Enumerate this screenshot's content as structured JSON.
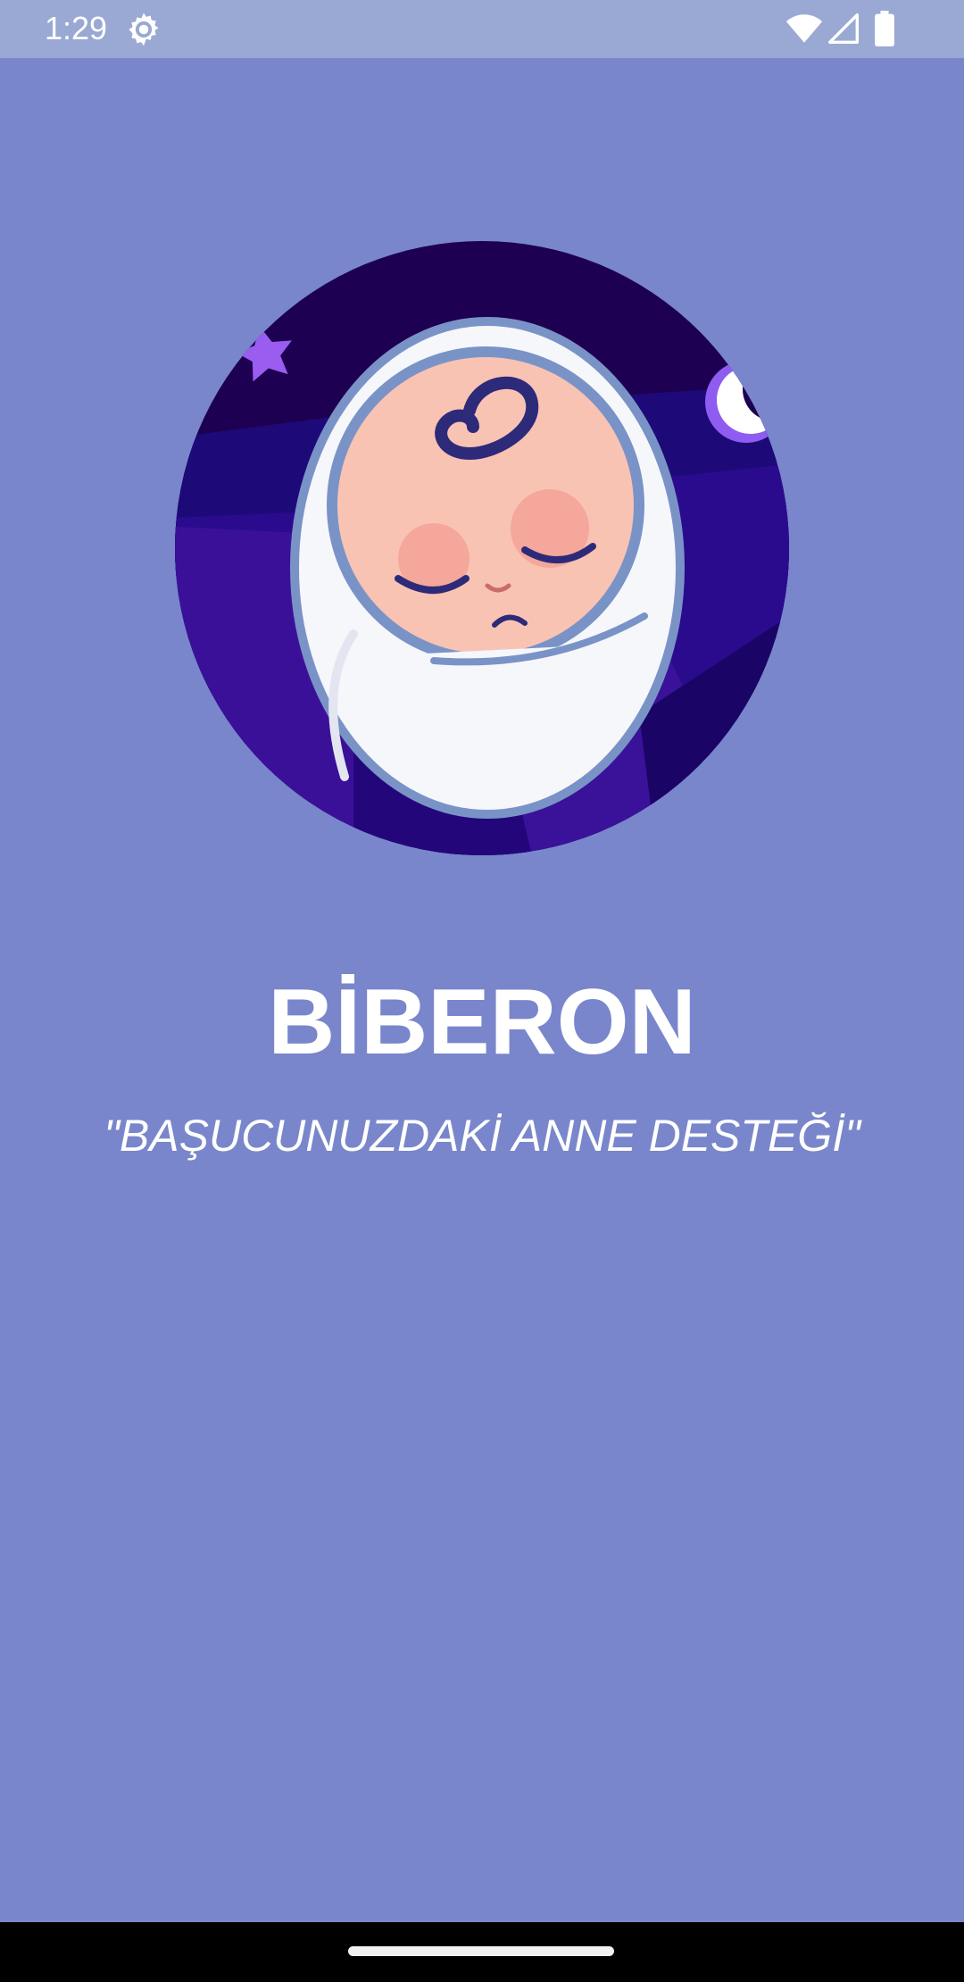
{
  "status_bar": {
    "time": "1:29",
    "icons": [
      "settings-gear-icon",
      "wifi-icon",
      "cell-signal-icon",
      "battery-icon"
    ]
  },
  "splash": {
    "logo_icon": "sleeping-baby-icon",
    "title": "BİBERON",
    "slogan": "\"BAŞUCUNUZDAKİ ANNE DESTEĞİ\""
  },
  "colors": {
    "background": "#7986cb",
    "status_bar": "#9aa9d3",
    "logo_circle": "#1e0052",
    "text": "#ffffff"
  }
}
